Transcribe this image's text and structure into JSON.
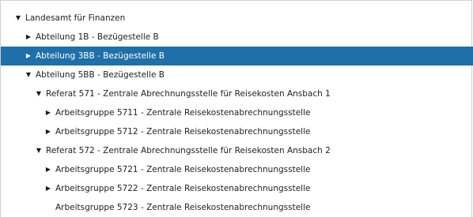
{
  "tree": {
    "nodes": [
      {
        "label": "Landesamt für Finanzen",
        "expander": "▼",
        "expanded": true,
        "selected": false
      },
      {
        "label": "Abteilung 1B - Bezügestelle B",
        "expander": "▶",
        "expanded": false,
        "selected": false
      },
      {
        "label": "Abteilung 3BB - Bezügestelle B",
        "expander": "▶",
        "expanded": false,
        "selected": true
      },
      {
        "label": "Abteilung 5BB - Bezügestelle B",
        "expander": "▼",
        "expanded": true,
        "selected": false
      },
      {
        "label": "Referat 571 - Zentrale Abrechnungsstelle für Reisekosten Ansbach 1",
        "expander": "▼",
        "expanded": true,
        "selected": false
      },
      {
        "label": "Arbeitsgruppe 5711 - Zentrale Reisekostenabrechnungsstelle",
        "expander": "▶",
        "expanded": false,
        "selected": false
      },
      {
        "label": "Arbeitsgruppe 5712 - Zentrale Reisekostenabrechnungsstelle",
        "expander": "▶",
        "expanded": false,
        "selected": false
      },
      {
        "label": "Referat 572 - Zentrale Abrechnungsstelle für Reisekosten Ansbach 2",
        "expander": "▼",
        "expanded": true,
        "selected": false
      },
      {
        "label": "Arbeitsgruppe 5721 - Zentrale Reisekostenabrechnungsstelle",
        "expander": "▶",
        "expanded": false,
        "selected": false
      },
      {
        "label": "Arbeitsgruppe 5722 - Zentrale Reisekostenabrechnungsstelle",
        "expander": "▶",
        "expanded": false,
        "selected": false
      },
      {
        "label": "Arbeitsgruppe 5723 - Zentrale Reisekostenabrechnungsstelle",
        "expander": "",
        "expanded": false,
        "selected": false
      }
    ]
  },
  "colors": {
    "selection_background": "#1f6fa8",
    "selection_text": "#ffffff",
    "text": "#222222"
  },
  "icons": {
    "expanded": "triangle-down-icon",
    "collapsed": "triangle-right-icon"
  }
}
